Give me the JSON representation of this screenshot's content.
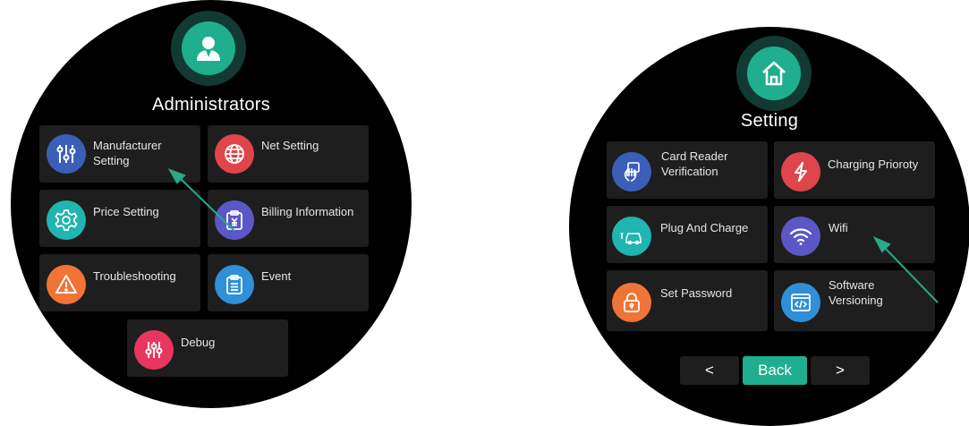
{
  "left_panel": {
    "title": "Administrators",
    "header_icon": "user-icon",
    "tiles": [
      {
        "label": "Manufacturer\nSetting",
        "icon": "sliders-icon",
        "color": "#3b5fb8"
      },
      {
        "label": "Net Setting",
        "icon": "globe-icon",
        "color": "#e0454b"
      },
      {
        "label": "Price Setting",
        "icon": "gear-icon",
        "color": "#1fb5b0"
      },
      {
        "label": "Billing Information",
        "icon": "receipt-icon",
        "color": "#5b57c7"
      },
      {
        "label": "Troubleshooting",
        "icon": "warning-icon",
        "color": "#f07436"
      },
      {
        "label": "Event",
        "icon": "clipboard-icon",
        "color": "#2f8fd8"
      },
      {
        "label": "Debug",
        "icon": "equalizer-icon",
        "color": "#e8365e"
      }
    ]
  },
  "right_panel": {
    "title": "Setting",
    "header_icon": "home-icon",
    "tiles": [
      {
        "label": "Card Reader\nVerification",
        "icon": "card-tap-icon",
        "color": "#3b5fb8"
      },
      {
        "label": "Charging Prioroty",
        "icon": "lightning-icon",
        "color": "#e0454b"
      },
      {
        "label": "Plug And Charge",
        "icon": "car-plug-icon",
        "color": "#1fb5b0"
      },
      {
        "label": "Wifi",
        "icon": "wifi-icon",
        "color": "#5b57c7"
      },
      {
        "label": "Set Password",
        "icon": "lock-icon",
        "color": "#f07436"
      },
      {
        "label": "Software\nVersioning",
        "icon": "code-icon",
        "color": "#2f8fd8"
      }
    ],
    "nav": {
      "prev_label": "<",
      "back_label": "Back",
      "next_label": ">"
    }
  },
  "colors": {
    "screen_bg": "#000000",
    "tile_bg": "#1e1e1e",
    "accent": "#1fae8e",
    "arrow": "#2aa889"
  }
}
